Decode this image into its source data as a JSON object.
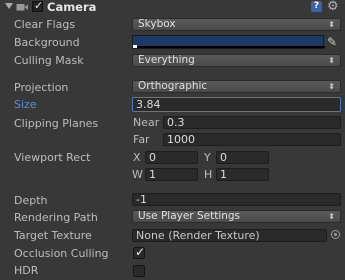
{
  "header": {
    "title": "Camera",
    "enabled": true,
    "help_icon_text": "?"
  },
  "clear_flags": {
    "label": "Clear Flags",
    "value": "Skybox"
  },
  "background": {
    "label": "Background",
    "color": "#1d3a66"
  },
  "culling_mask": {
    "label": "Culling Mask",
    "value": "Everything"
  },
  "projection": {
    "label": "Projection",
    "value": "Orthographic"
  },
  "size": {
    "label": "Size",
    "value": "3.84"
  },
  "clipping_planes": {
    "label": "Clipping Planes",
    "near_label": "Near",
    "near_value": "0.3",
    "far_label": "Far",
    "far_value": "1000"
  },
  "viewport_rect": {
    "label": "Viewport Rect",
    "x_label": "X",
    "x_value": "0",
    "y_label": "Y",
    "y_value": "0",
    "w_label": "W",
    "w_value": "1",
    "h_label": "H",
    "h_value": "1"
  },
  "depth": {
    "label": "Depth",
    "value": "-1"
  },
  "rendering_path": {
    "label": "Rendering Path",
    "value": "Use Player Settings"
  },
  "target_texture": {
    "label": "Target Texture",
    "value": "None (Render Texture)"
  },
  "occlusion_culling": {
    "label": "Occlusion Culling",
    "checked": true
  },
  "hdr": {
    "label": "HDR",
    "checked": false
  },
  "icons": {
    "foldout": "foldout-arrow-icon",
    "camera": "camera-icon",
    "help": "help-icon",
    "settings": "gear-icon",
    "eyedropper": "eyedropper-icon",
    "object_picker": "object-picker-icon",
    "dropdown": "dropdown-arrow-icon"
  }
}
